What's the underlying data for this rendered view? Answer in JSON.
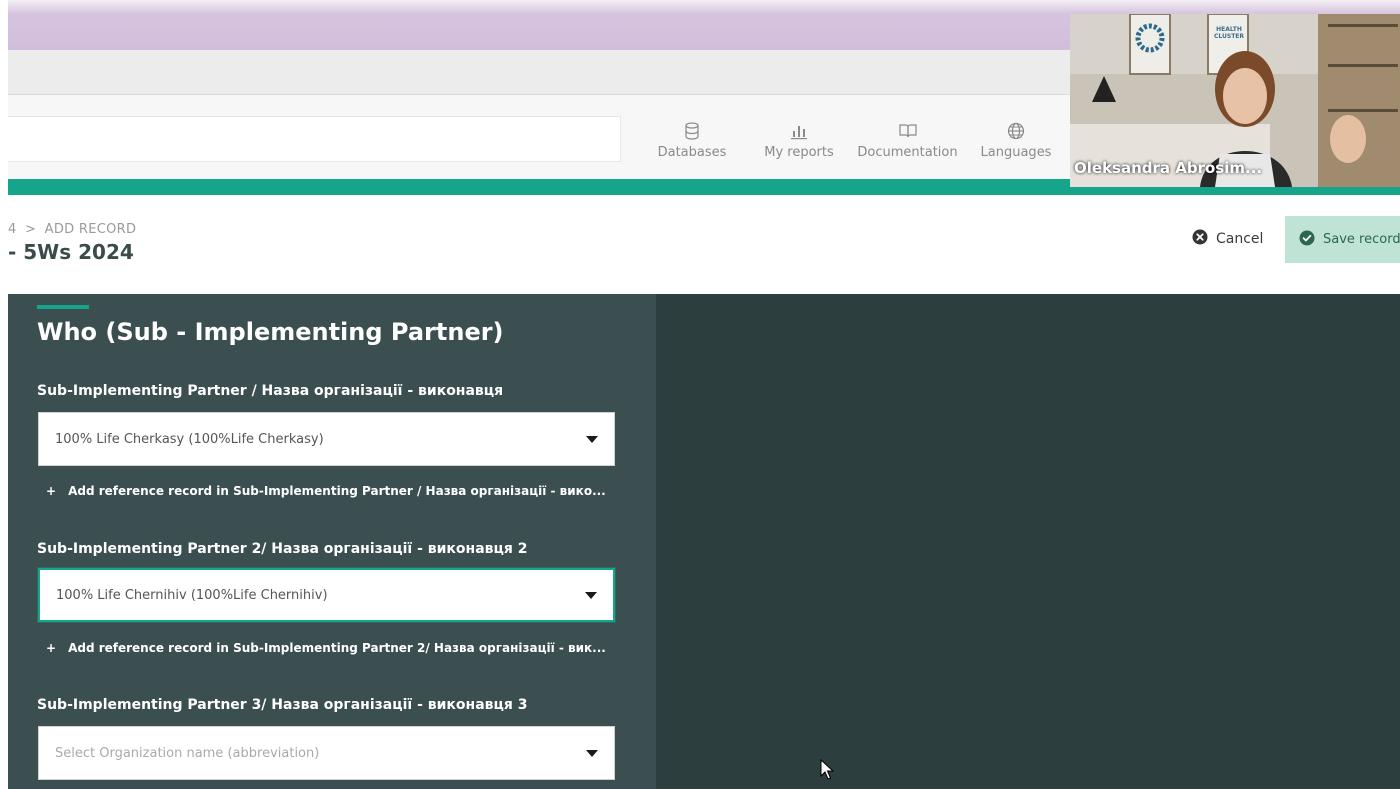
{
  "topnav": {
    "items": [
      {
        "label": "Databases",
        "icon": "database-icon"
      },
      {
        "label": "My reports",
        "icon": "bar-chart-icon"
      },
      {
        "label": "Documentation",
        "icon": "book-icon"
      },
      {
        "label": "Languages",
        "icon": "globe-icon"
      }
    ]
  },
  "breadcrumb": {
    "prefix": "4",
    "separator": ">",
    "current": "ADD RECORD"
  },
  "form": {
    "title": "- 5Ws 2024"
  },
  "actions": {
    "cancel_label": "Cancel",
    "save_label": "Save record"
  },
  "section": {
    "title": "Who (Sub - Implementing Partner)",
    "fields": [
      {
        "label": "Sub-Implementing Partner / Назва організації - виконавця",
        "value": "100% Life Cherkasy (100%Life Cherkasy)",
        "add_ref": "Add reference record in Sub-Implementing Partner / Назва організації - вико..."
      },
      {
        "label": "Sub-Implementing Partner 2/ Назва організації - виконавця 2",
        "value": "100% Life Chernihiv (100%Life Chernihiv)",
        "add_ref": "Add reference record in Sub-Implementing Partner 2/ Назва організації - вик..."
      },
      {
        "label": "Sub-Implementing Partner 3/ Назва організації - виконавця 3",
        "placeholder": "Select Organization name (abbreviation)"
      }
    ]
  },
  "video": {
    "participant_name": "Oleksandra Abrosim...",
    "poster_text": "HEALTH CLUSTER"
  },
  "colors": {
    "accent": "#16a58a",
    "panel": "#3c4f50",
    "dark_bg": "#2d3e3e",
    "save_bg": "#bfe4d6"
  }
}
